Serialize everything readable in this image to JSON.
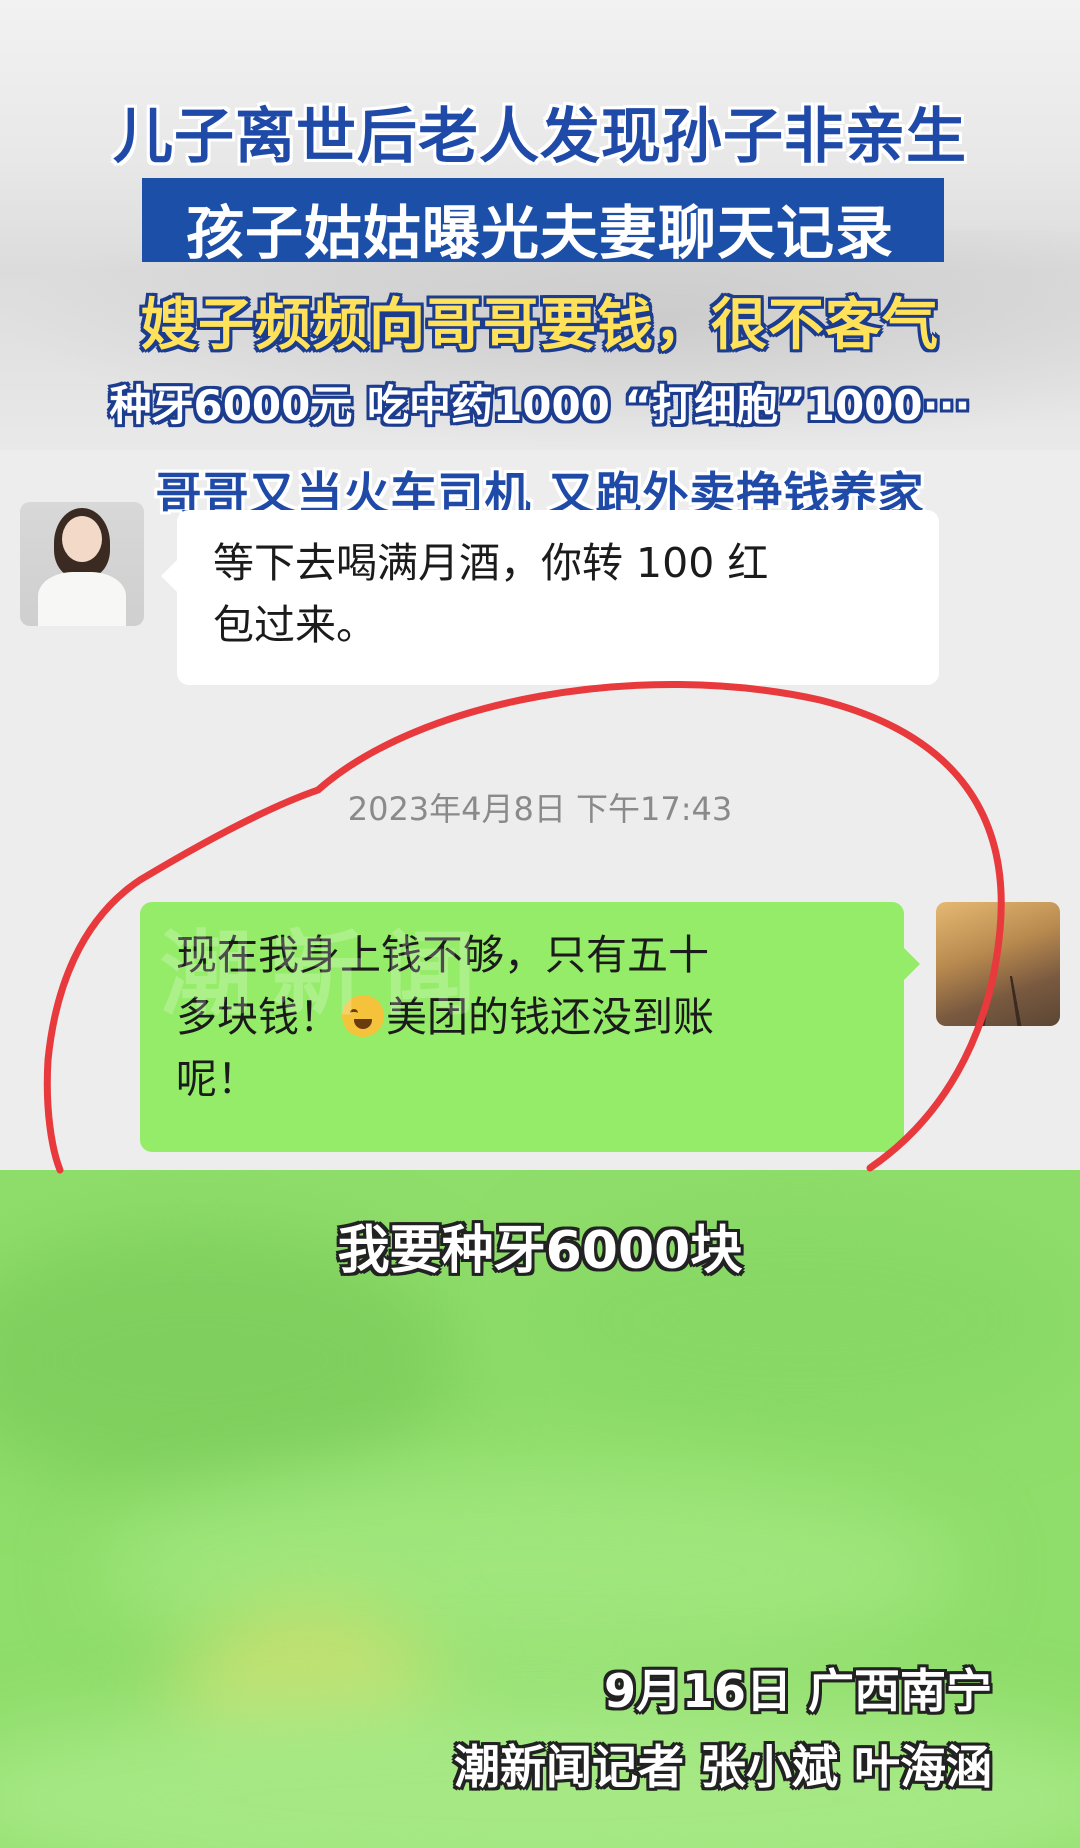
{
  "headline": {
    "line1": "儿子离世后老人发现孙子非亲生",
    "line2": "孩子姑姑曝光夫妻聊天记录",
    "line3": "嫂子频频向哥哥要钱，很不客气",
    "line4": "种牙6000元 吃中药1000 “打细胞”1000···",
    "line5": "哥哥又当火车司机 又跑外卖挣钱养家"
  },
  "chat": {
    "incoming": {
      "line1": "等下去喝满月酒，你转 100 红",
      "line2": "包过来。"
    },
    "timestamp": "2023年4月8日 下午17:43",
    "outgoing": {
      "line1": "现在我身上钱不够，只有五十",
      "line2_a": "多块钱！",
      "line2_b": "美团的钱还没到账",
      "line3": "呢！",
      "emoji": "crying-laughing-emoji"
    },
    "watermark": "潮新闻"
  },
  "subtitle": "我要种牙6000块",
  "credit": {
    "date_place": "9月16日 广西南宁",
    "reporters": "潮新闻记者 张小斌 叶海涵"
  },
  "colors": {
    "headline_blue": "#1c4fa8",
    "headline_yellow": "#ffe25a",
    "bubble_green": "#95ec69",
    "chat_bg": "#ededed",
    "annotation_red": "#e8393d"
  }
}
